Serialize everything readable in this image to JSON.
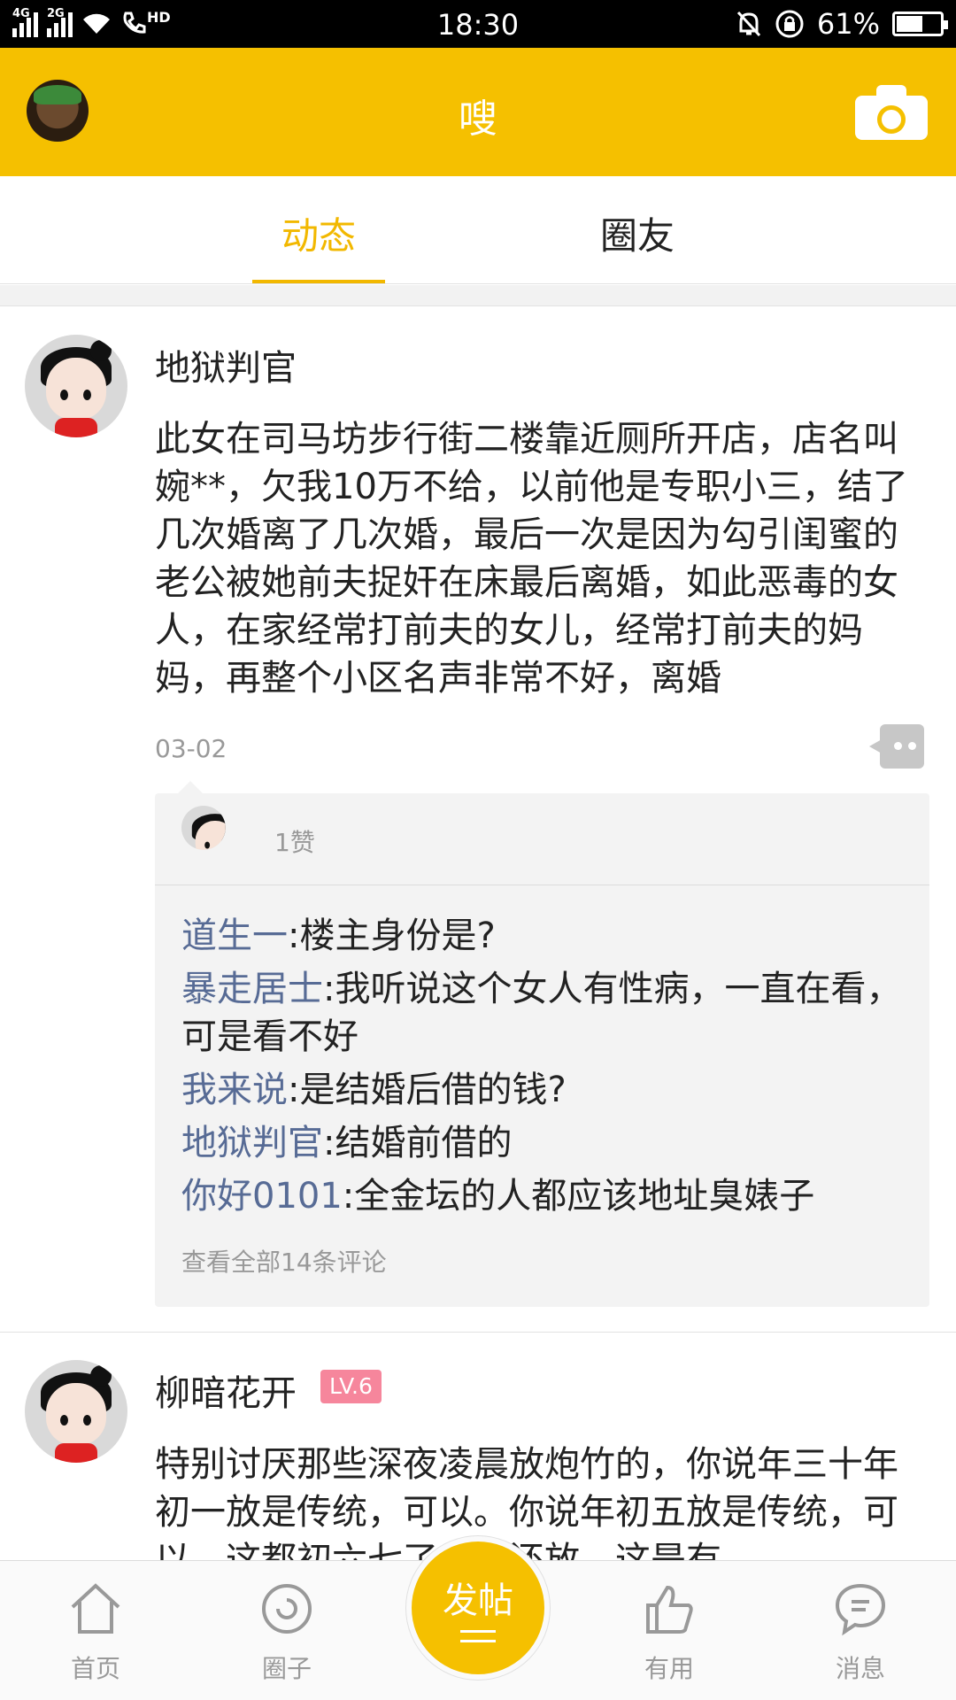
{
  "status_bar": {
    "network_1": "4G",
    "network_2": "2G",
    "hd": "HD",
    "time": "18:30",
    "battery": "61%",
    "battery_level": 0.61
  },
  "header": {
    "title": "嗖",
    "avatar_icon": "user-avatar",
    "camera_icon": "camera-icon"
  },
  "tabs": [
    {
      "label": "动态",
      "active": true
    },
    {
      "label": "圈友",
      "active": false
    }
  ],
  "posts": [
    {
      "author": "地狱判官",
      "text": "此女在司马坊步行街二楼靠近厕所开店，店名叫婉**，欠我10万不给，以前他是专职小三，结了几次婚离了几次婚，最后一次是因为勾引闺蜜的老公被她前夫捉奸在床最后离婚，如此恶毒的女人，在家经常打前夫的女儿，经常打前夫的妈妈，再整个小区名声非常不好，离婚",
      "date": "03-02",
      "likes": "1赞",
      "comments": [
        {
          "user": "道生一",
          "text": ":楼主身份是?"
        },
        {
          "user": "暴走居士",
          "text": ":我听说这个女人有性病，一直在看，可是看不好"
        },
        {
          "user": "我来说",
          "text": ":是结婚后借的钱?"
        },
        {
          "user": "地狱判官",
          "text": ":结婚前借的"
        },
        {
          "user": "你好0101",
          "text": ":全金坛的人都应该地址臭婊子"
        }
      ],
      "view_all": "查看全部14条评论"
    },
    {
      "author": "柳暗花开",
      "level": "LV.6",
      "text": "特别讨厌那些深夜凌晨放炮竹的，你说年三十年初一放是传统，可以。你说年初五放是传统，可以，这都初六七了，你还放，这是有"
    }
  ],
  "bottom_nav": {
    "home": "首页",
    "circle": "圈子",
    "post": "发帖",
    "useful": "有用",
    "messages": "消息"
  },
  "colors": {
    "brand": "#f5c000",
    "tab_active": "#f2b800",
    "comment_user": "#576b95",
    "level_badge": "#f6869c"
  }
}
